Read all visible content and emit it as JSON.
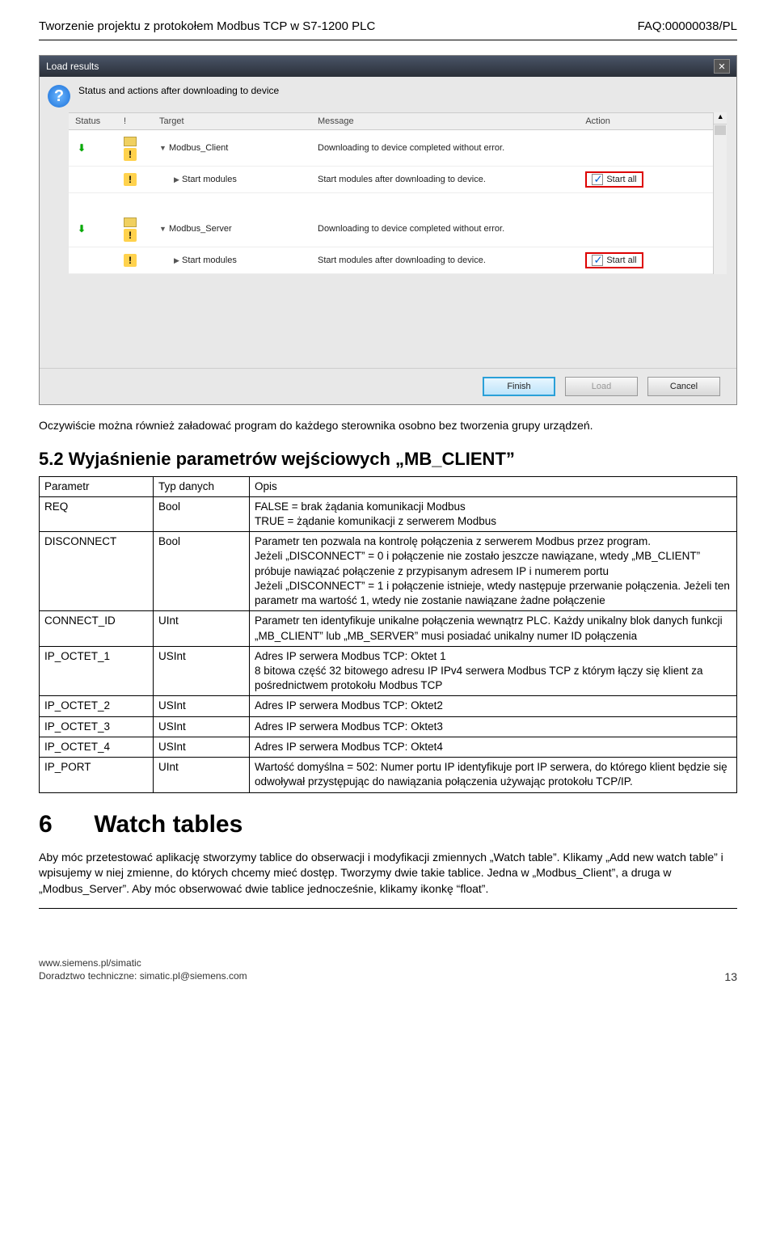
{
  "header": {
    "left": "Tworzenie projektu z protokołem Modbus TCP w S7-1200 PLC",
    "right": "FAQ:00000038/PL"
  },
  "dialog": {
    "title": "Load results",
    "subtitle": "Status and actions after downloading to device",
    "cols": {
      "status": "Status",
      "i": "!",
      "target": "Target",
      "message": "Message",
      "action": "Action"
    },
    "rows": [
      {
        "target": "Modbus_Client",
        "message": "Downloading to device completed without error.",
        "action": "",
        "expand": true,
        "warn": true,
        "dn": true,
        "chip": true
      },
      {
        "target": "Start modules",
        "message": "Start modules after downloading to device.",
        "action": "Start all",
        "expand": false,
        "warn": true,
        "boxed": true
      },
      {
        "target": "Modbus_Server",
        "message": "Downloading to device completed without error.",
        "action": "",
        "expand": true,
        "warn": true,
        "dn": true,
        "chip": true
      },
      {
        "target": "Start modules",
        "message": "Start modules after downloading to device.",
        "action": "Start all",
        "expand": false,
        "warn": true,
        "boxed": true
      }
    ],
    "buttons": {
      "finish": "Finish",
      "load": "Load",
      "cancel": "Cancel"
    }
  },
  "text_after_dialog": "Oczywiście można również załadować program do każdego sterownika osobno bez tworzenia grupy urządzeń.",
  "section5_title": "5.2 Wyjaśnienie parametrów wejściowych „MB_CLIENT”",
  "param_cols": {
    "name": "Parametr",
    "type": "Typ danych",
    "desc": "Opis"
  },
  "params": [
    {
      "name": "REQ",
      "type": "Bool",
      "desc": [
        "FALSE = brak żądania komunikacji Modbus",
        "TRUE = żądanie komunikacji z serwerem Modbus"
      ]
    },
    {
      "name": "DISCONNECT",
      "type": "Bool",
      "desc": [
        "Parametr ten pozwala na kontrolę połączenia z serwerem Modbus przez program.",
        "Jeżeli „DISCONNECT” = 0 i połączenie nie zostało jeszcze nawiązane, wtedy „MB_CLIENT” próbuje nawiązać połączenie z przypisanym adresem IP i numerem portu",
        "Jeżeli „DISCONNECT” = 1 i połączenie istnieje, wtedy następuje przerwanie połączenia. Jeżeli ten parametr ma wartość 1, wtedy nie zostanie nawiązane żadne połączenie"
      ]
    },
    {
      "name": "CONNECT_ID",
      "type": "UInt",
      "desc": [
        "Parametr ten identyfikuje unikalne połączenia wewnątrz PLC. Każdy unikalny blok danych funkcji „MB_CLIENT” lub „MB_SERVER” musi posiadać unikalny numer ID połączenia"
      ]
    },
    {
      "name": "IP_OCTET_1",
      "type": "USInt",
      "desc": [
        "Adres IP serwera Modbus TCP: Oktet 1",
        "8 bitowa część 32 bitowego adresu IP IPv4 serwera Modbus TCP z którym łączy się klient za pośrednictwem protokołu Modbus TCP"
      ]
    },
    {
      "name": "IP_OCTET_2",
      "type": "USInt",
      "desc": [
        "Adres IP serwera Modbus TCP: Oktet2"
      ]
    },
    {
      "name": "IP_OCTET_3",
      "type": "USInt",
      "desc": [
        "Adres IP serwera Modbus TCP: Oktet3"
      ]
    },
    {
      "name": "IP_OCTET_4",
      "type": "USInt",
      "desc": [
        "Adres IP serwera Modbus TCP: Oktet4"
      ]
    },
    {
      "name": "IP_PORT",
      "type": "UInt",
      "desc": [
        "Wartość domyślna = 502: Numer portu IP identyfikuje port IP serwera, do którego klient będzie się odwoływał przystępując do nawiązania połączenia używając protokołu TCP/IP."
      ]
    }
  ],
  "section6": {
    "num": "6",
    "title": "Watch tables",
    "para": "Aby móc przetestować aplikację stworzymy tablice do obserwacji i modyfikacji zmiennych „Watch table”. Klikamy „Add new watch table” i wpisujemy w niej zmienne, do których chcemy mieć dostęp. Tworzymy dwie takie tablice. Jedna w „Modbus_Client”, a druga w „Modbus_Server”. Aby móc obserwować dwie tablice jednocześnie, klikamy ikonkę “float”."
  },
  "footer": {
    "line1": "www.siemens.pl/simatic",
    "line2": "Doradztwo techniczne: simatic.pl@siemens.com",
    "page": "13"
  }
}
